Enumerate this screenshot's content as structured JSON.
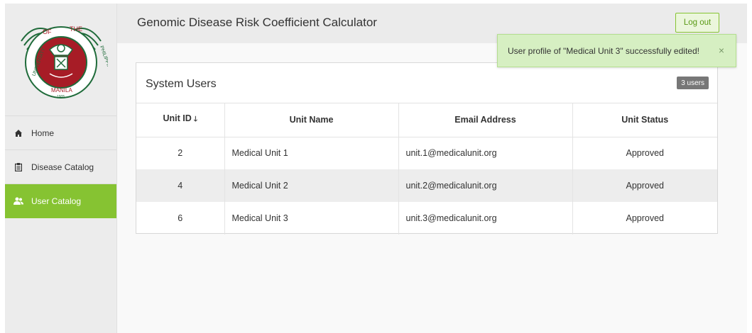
{
  "header": {
    "title": "Genomic Disease Risk Coefficient Calculator",
    "logout_label": "Log out"
  },
  "logo": {
    "text_top_left": "OF",
    "text_top_right": "THE",
    "text_left": "UNIVERSITY",
    "text_right": "PHILIPPINES",
    "text_bottom": "MANILA",
    "year": "1905"
  },
  "sidebar": {
    "items": [
      {
        "label": "Home",
        "icon": "home-icon",
        "active": false
      },
      {
        "label": "Disease Catalog",
        "icon": "clipboard-icon",
        "active": false
      },
      {
        "label": "User Catalog",
        "icon": "users-icon",
        "active": true
      }
    ]
  },
  "toast": {
    "message": "User profile of \"Medical Unit 3\" successfully edited!",
    "close_label": "×"
  },
  "panel": {
    "title": "System Users",
    "badge": "3 users"
  },
  "table": {
    "columns": [
      "Unit ID",
      "Unit Name",
      "Email Address",
      "Unit Status"
    ],
    "sort_indicator": "🡓",
    "rows": [
      {
        "id": "2",
        "name": "Medical Unit 1",
        "email": "unit.1@medicalunit.org",
        "status": "Approved"
      },
      {
        "id": "4",
        "name": "Medical Unit 2",
        "email": "unit.2@medicalunit.org",
        "status": "Approved"
      },
      {
        "id": "6",
        "name": "Medical Unit 3",
        "email": "unit.3@medicalunit.org",
        "status": "Approved"
      }
    ]
  },
  "colors": {
    "accent": "#86c332",
    "logo_red": "#a71c26",
    "logo_green": "#1f6b3a"
  }
}
